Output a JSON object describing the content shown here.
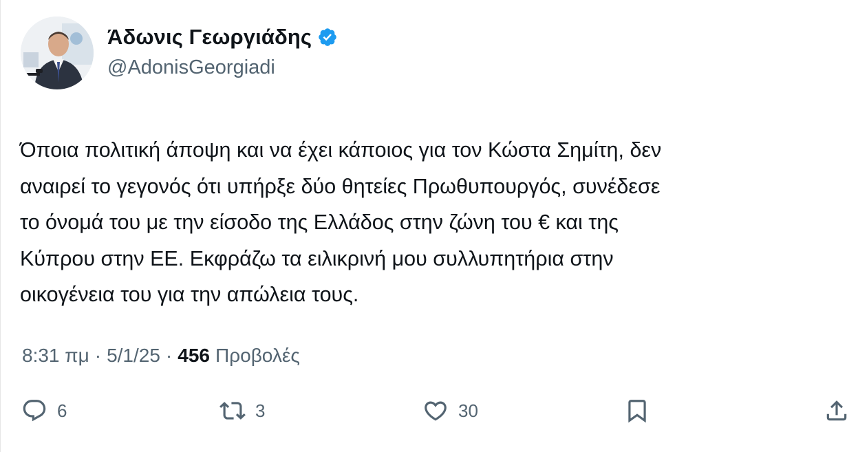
{
  "author": {
    "display_name": "Άδωνις Γεωργιάδης",
    "handle": "@AdonisGeorgiadi",
    "verified": true,
    "verified_color": "#1d9bf0"
  },
  "tweet": {
    "text": "Όποια πολιτική άποψη και να έχει κάποιος για τον Κώστα Σημίτη, δεν\nαναιρεί το γεγονός ότι υπήρξε δύο θητείες Πρωθυπουργός, συνέδεσε\nτο όνομά του με την είσοδο της Ελλάδος στην ζώνη του € και της\nΚύπρου στην ΕΕ. Εκφράζω τα ειλικρινή μου συλλυπητήρια στην\nοικογένεια του για την απώλεια τους."
  },
  "meta": {
    "time": "8:31 πμ",
    "separator": "·",
    "date": "5/1/25",
    "views_count": "456",
    "views_label": "Προβολές"
  },
  "actions": {
    "replies": "6",
    "retweets": "3",
    "likes": "30"
  },
  "colors": {
    "text_primary": "#0f1419",
    "text_secondary": "#536471",
    "accent": "#1d9bf0"
  }
}
